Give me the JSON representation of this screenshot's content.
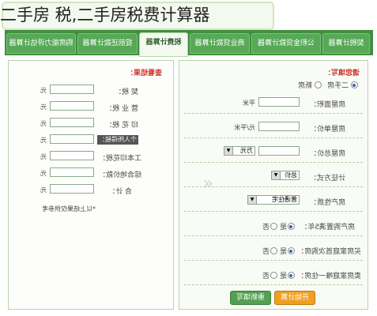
{
  "title": "二手房 税,二手房税费计算器",
  "tabs": [
    {
      "label": "契税计算器"
    },
    {
      "label": "公积金贷款计算器"
    },
    {
      "label": "商业贷款计算器"
    },
    {
      "label": "税费计算器"
    },
    {
      "label": "提前还款计算器"
    },
    {
      "label": "购房能力评估计算器"
    }
  ],
  "form": {
    "title": "请您填写：",
    "house_type": {
      "option1": "二手房",
      "option2": "新房"
    },
    "area_label": "房屋面积：",
    "area_unit": "平米",
    "price_label": "房屋单价：",
    "price_unit": "元/平米",
    "total_label": "房屋总价：",
    "total_unit": "万元",
    "calc_method_label": "计征方式：",
    "calc_method_value": "总价",
    "property_label": "房产性质：",
    "property_value": "普通住宅",
    "q1_label": "房产购置满5年：",
    "q2_label": "买房家庭首次购房：",
    "q3_label": "卖房家庭唯一住房：",
    "yes": "是",
    "no": "否",
    "calc_button": "开始计算",
    "reset_button": "重新填写"
  },
  "result": {
    "title": "查看结果：",
    "rows": [
      {
        "label": "契 税：",
        "unit": "元"
      },
      {
        "label": "营 业 税：",
        "unit": "元"
      },
      {
        "label": "印 花 税：",
        "unit": "元"
      },
      {
        "label": "个人所得税：",
        "unit": "元"
      },
      {
        "label": "工本印花税：",
        "unit": "元"
      },
      {
        "label": "综合地价款：",
        "unit": "元"
      },
      {
        "label": "合 计：",
        "unit": "元"
      }
    ],
    "note": "*以上结果仅供参考"
  }
}
